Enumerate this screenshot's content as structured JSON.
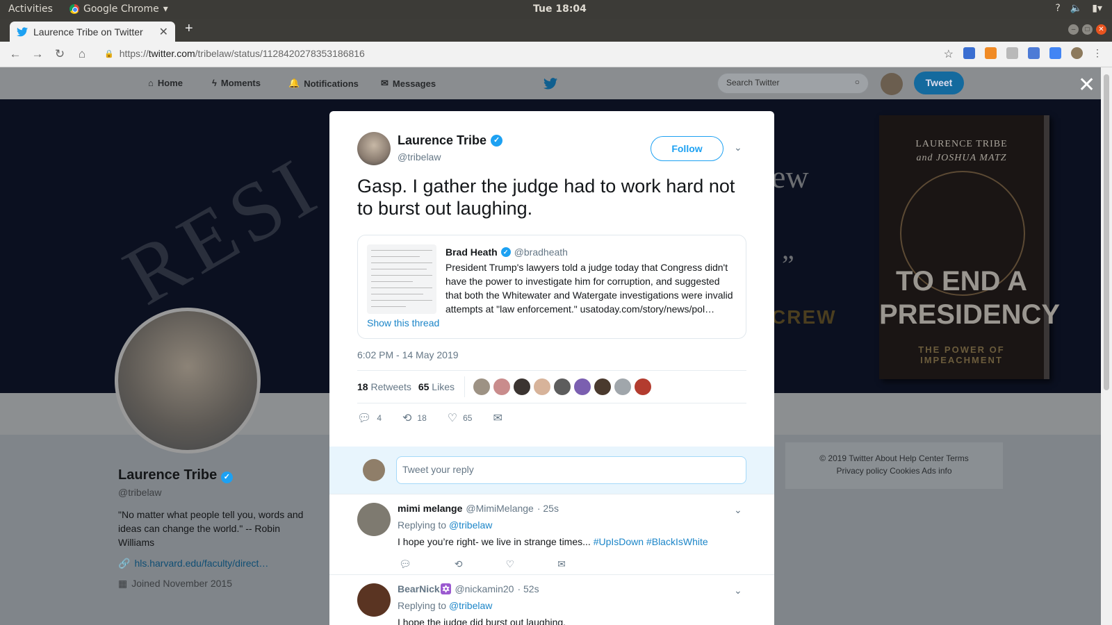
{
  "os": {
    "activities": "Activities",
    "app": "Google Chrome",
    "clock": "Tue 18:04"
  },
  "browser": {
    "tab_title": "Laurence Tribe on Twitter",
    "url_prefix": "https://",
    "url_host": "twitter.com",
    "url_path": "/tribelaw/status/1128420278353186816"
  },
  "twitter_nav": {
    "home": "Home",
    "moments": "Moments",
    "notifications": "Notifications",
    "messages": "Messages",
    "search_placeholder": "Search Twitter",
    "tweet_button": "Tweet"
  },
  "banner": {
    "seal_text": "RESI",
    "ew": "ew",
    "crew": "CREW",
    "book_authors_line1": "LAURENCE TRIBE",
    "book_authors_line2": "and JOSHUA MATZ",
    "book_title": "TO END A PRESIDENCY",
    "book_subtitle": "THE POWER OF IMPEACHMENT"
  },
  "profile": {
    "name": "Laurence Tribe",
    "handle": "@tribelaw",
    "bio": "\"No matter what people tell you, words and ideas can change the world.\" -- Robin Williams",
    "link": "hls.harvard.edu/faculty/direct…",
    "joined": "Joined November 2015"
  },
  "footer": {
    "line1": "© 2019 Twitter   About   Help Center   Terms",
    "line2": "Privacy policy   Cookies   Ads info"
  },
  "tweet": {
    "name": "Laurence Tribe",
    "handle": "@tribelaw",
    "follow": "Follow",
    "text": "Gasp. I gather the judge had to work hard not to burst out laughing.",
    "quote": {
      "name": "Brad Heath",
      "handle": "@bradheath",
      "text": "President Trump's lawyers told a judge today that Congress didn't have the power to investigate him for corruption, and suggested that both the Whitewater and Watergate investigations were invalid attempts at \"law enforcement.\" usatoday.com/story/news/pol…",
      "show_thread": "Show this thread"
    },
    "timestamp": "6:02 PM - 14 May 2019",
    "retweets_count": "18",
    "retweets_label": "Retweets",
    "likes_count": "65",
    "likes_label": "Likes",
    "liker_colors": [
      "#9d9284",
      "#c98c8c",
      "#3b3431",
      "#d7b39a",
      "#5d5d5d",
      "#7b5fb0",
      "#4a3a2e",
      "#a0a6ab",
      "#b33c2f"
    ],
    "action_replies": "4",
    "action_retweets": "18",
    "action_likes": "65",
    "reply_placeholder": "Tweet your reply"
  },
  "replies": [
    {
      "name": "mimi melange",
      "handle": "@MimiMelange",
      "time": "· 25s",
      "replying_prefix": "Replying to",
      "replying_to": "@tribelaw",
      "text": "I hope you’re right- we live in strange times...",
      "tags": "#UpIsDown #BlackIsWhite",
      "avatar_color": "#7e7a70"
    },
    {
      "name": "BearNick",
      "name_emoji": "✡",
      "handle": "@nickamin20",
      "time": "· 52s",
      "replying_prefix": "Replying to",
      "replying_to": "@tribelaw",
      "text": "I hope the judge did burst out laughing.",
      "avatar_color": "#5a3422"
    }
  ]
}
